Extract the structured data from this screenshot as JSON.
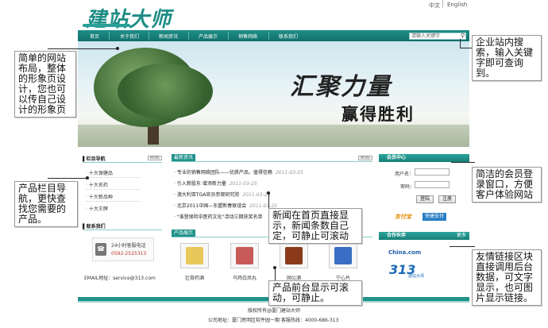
{
  "header": {
    "logo_text": "建站大师",
    "lang_cn": "中文",
    "lang_en": "English"
  },
  "nav": {
    "items": [
      "首页",
      "关于我们",
      "新闻资讯",
      "产品展示",
      "销售网络",
      "联系我们"
    ],
    "search_placeholder": "请输入关键字"
  },
  "banner": {
    "slogan_line1": "汇聚力量",
    "slogan_line2": "赢得胜利"
  },
  "left": {
    "category_title": "栏目导航",
    "categories": [
      "十大保健品",
      "十大名药",
      "十大新品种",
      "十大王牌"
    ],
    "contact_title": "联系我们",
    "phone_label": "24小时客服电话",
    "phone_number": "0592-2525313",
    "email": "EMAIL地址：service@313.com",
    "more_label": "MORE"
  },
  "news": {
    "title": "最新资讯",
    "more_label": "MORE",
    "items": [
      {
        "text": "专业的销售网络团队——优质产品，值得信赖",
        "date": "2011-03-25"
      },
      {
        "text": "引入新股东 增添新力量",
        "date": "2011-03-25"
      },
      {
        "text": "澳大利亚TGA官员参观研究院",
        "date": "2011-03-25"
      },
      {
        "text": "北京2011中国—东盟新春联谊会",
        "date": "2011-03-25"
      },
      {
        "text": "\"谁登保险中医药文化\"活动三期获奖名单",
        "date": ""
      }
    ]
  },
  "products": {
    "title": "产品展示",
    "items": [
      "壮骨药酒",
      "乌鸡白凤丸",
      "固公酒",
      "宁心片"
    ]
  },
  "member": {
    "title": "会员中心",
    "username_label": "用户名：",
    "password_label": "密码：",
    "login_label": "登陆",
    "register_label": "注册",
    "alipay_text": "支付宝",
    "quick_pay": "快捷支付"
  },
  "partners": {
    "title": "合作伙伴",
    "more_label": "更多",
    "china_logo": "China.com",
    "logo_313": "313",
    "logo_313_sub": "建站大师"
  },
  "footer": {
    "copyright": "版权所有@厦门建站大师",
    "address": "公司地址：厦门思明区软件园一期 客服热线：4000-686-313"
  },
  "annotations": {
    "left_top": "简单的网站布局，整体的形象页设计，您也可以传自己设计的形象页",
    "left_bottom": "产品栏目导航，更快查找您需要的产品。",
    "right_search": "企业站内搜索，输入关键字即可查询到。",
    "right_member": "简洁的会员登录窗口，方便客户体验网站",
    "right_links": "友情链接区块直接调用后台数据，可文字显示，也可图片显示链接。",
    "news_note": "新闻在首页直接显示，新闻条数自己定，可静止可滚动",
    "product_note": "产品前台显示可滚动，可静止。"
  },
  "colors": {
    "brand_teal": "#1f8f88",
    "logo_teal": "#1d8d85",
    "date_gray": "#999999",
    "phone_red": "#c0392b"
  }
}
